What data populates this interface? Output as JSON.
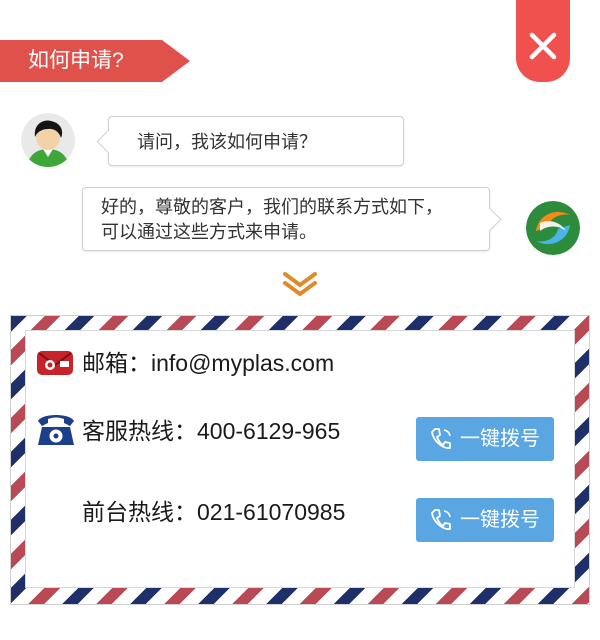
{
  "header": {
    "title": "如何申请?",
    "close_icon": "close-icon"
  },
  "chat": {
    "question": "请问，我该如何申请？",
    "answer_line1": "好的，尊敬的客户，我们的联系方式如下，",
    "answer_line2": "可以通过这些方式来申请。"
  },
  "contacts": {
    "email_label": "邮箱：info@myplas.com",
    "service_label": "客服热线：400-6129-965",
    "front_label": "前台热线：021-61070985",
    "call_button_label": "一键拨号"
  },
  "colors": {
    "accent_red": "#e0514b",
    "close_red": "#f0514f",
    "button_blue": "#5aa6e3",
    "stripe_navy": "#1f2f6a",
    "stripe_red": "#b84a55",
    "chevron_orange": "#e08a2a"
  },
  "icons": [
    "close-icon",
    "user-avatar",
    "brand-logo",
    "mail-icon",
    "telephone-icon",
    "phone-icon",
    "chevron-down-icon"
  ]
}
